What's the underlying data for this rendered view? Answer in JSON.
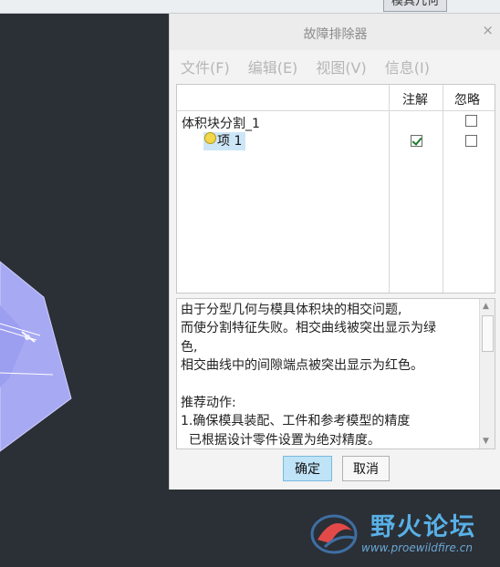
{
  "top_tab": {
    "label": "模具几何"
  },
  "dialog": {
    "title": "故障排除器",
    "close_glyph": "×",
    "menu": [
      {
        "label": "文件(F)"
      },
      {
        "label": "编辑(E)"
      },
      {
        "label": "视图(V)"
      },
      {
        "label": "信息(I)"
      }
    ],
    "tree": {
      "headers": {
        "annotate": "注解",
        "ignore": "忽略"
      },
      "group_label": "体积块分割_1",
      "item_label": "项 1",
      "item_annotate_checked": true,
      "item_ignore_checked": false,
      "group_ignore_checked": false
    },
    "message_lines": [
      "由于分型几何与模具体积块的相交问题,",
      "而使分割特征失败。相交曲线被突出显示为绿",
      "色,",
      "相交曲线中的间隙端点被突出显示为红色。",
      "",
      "推荐动作:",
      "1.确保模具装配、工件和参考模型的精度",
      "  已根据设计零件设置为绝对精度。"
    ],
    "buttons": {
      "ok": "确定",
      "cancel": "取消"
    }
  },
  "watermark": {
    "name": "野火论坛",
    "url": "www.proewildfire.cn"
  },
  "colors": {
    "accent": "#bfe3f7",
    "selection": "#cde6f7",
    "geometry": "#a7a9f3"
  }
}
